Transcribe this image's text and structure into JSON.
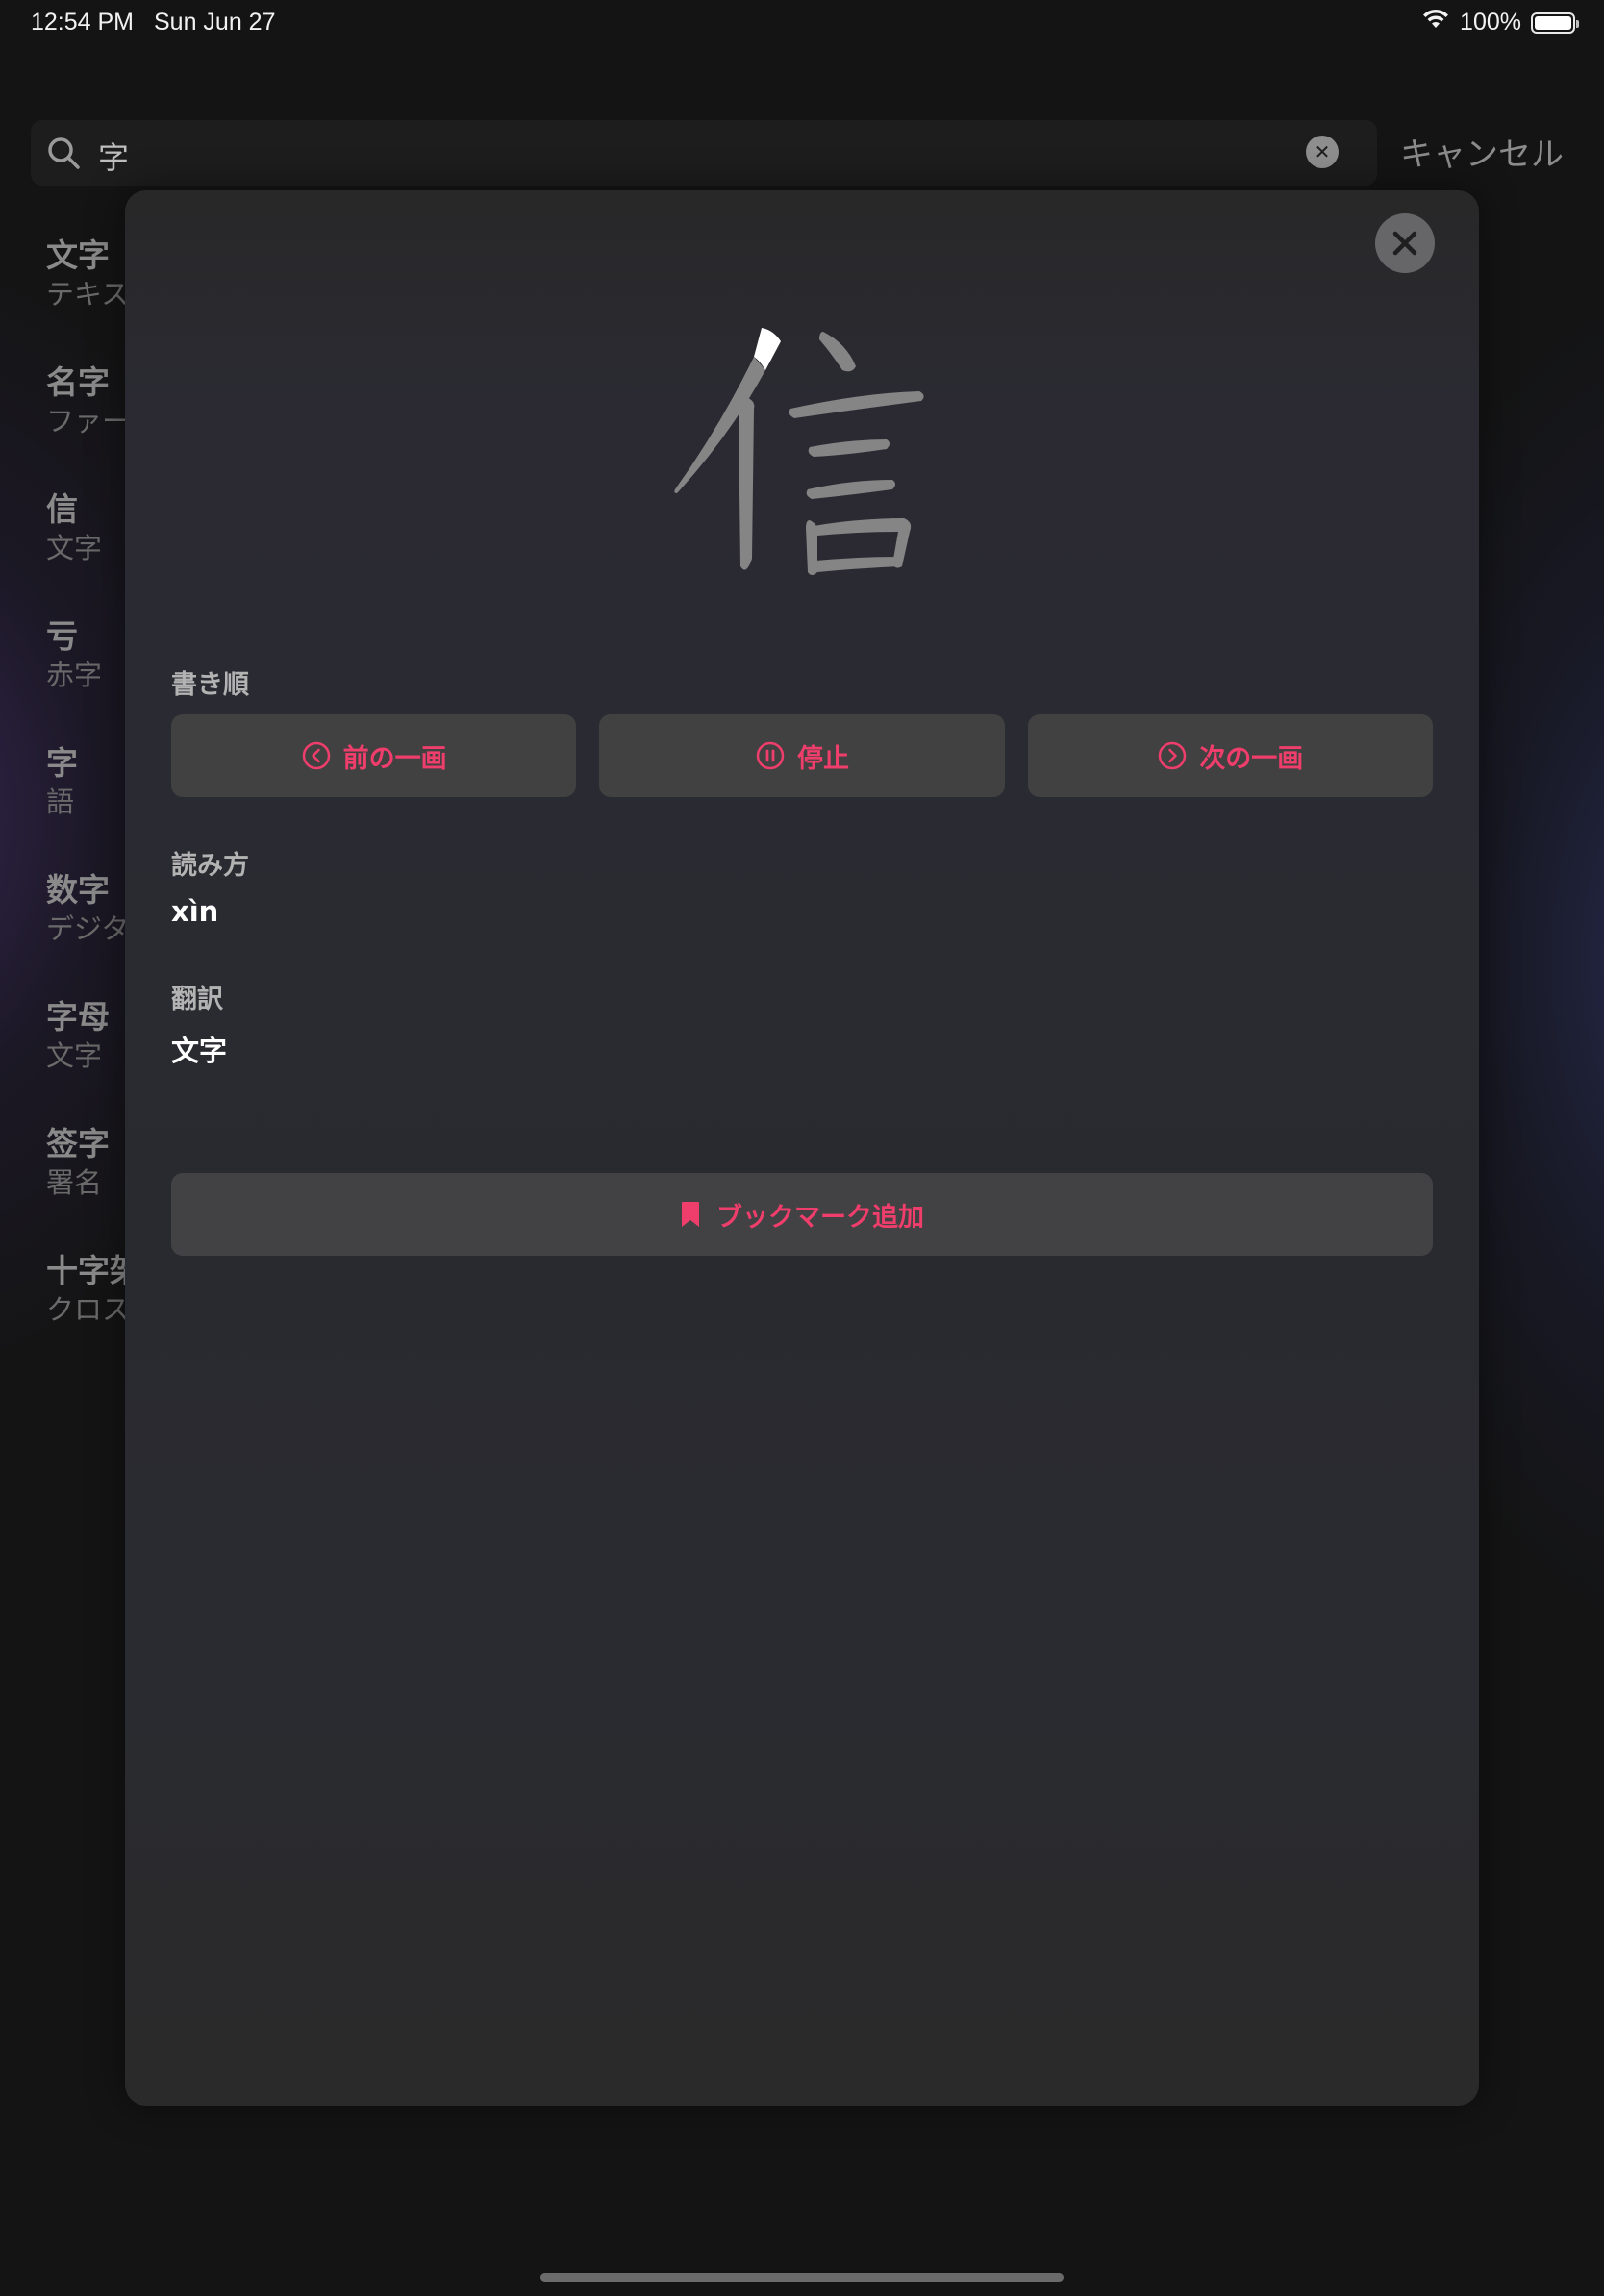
{
  "status_bar": {
    "time": "12:54 PM",
    "date": "Sun Jun 27",
    "battery_percent": "100%",
    "battery_level": 1.0
  },
  "search": {
    "query": "字",
    "cancel_label": "キャンセル"
  },
  "results": [
    {
      "title": "文字",
      "subtitle": "テキスト"
    },
    {
      "title": "名字",
      "subtitle": "ファーストネーム"
    },
    {
      "title": "信",
      "subtitle": "文字"
    },
    {
      "title": "亏",
      "subtitle": "赤字"
    },
    {
      "title": "字",
      "subtitle": "語"
    },
    {
      "title": "数字",
      "subtitle": "デジタル"
    },
    {
      "title": "字母",
      "subtitle": "文字"
    },
    {
      "title": "签字",
      "subtitle": "署名"
    },
    {
      "title": "十字架",
      "subtitle": "クロス"
    }
  ],
  "detail": {
    "character": "信",
    "stroke_order_label": "書き順",
    "prev_stroke_label": "前の一画",
    "stop_label": "停止",
    "next_stroke_label": "次の一画",
    "reading_label": "読み方",
    "reading_value": "xìn",
    "translation_label": "翻訳",
    "translation_value": "文字",
    "bookmark_label": "ブックマーク追加"
  },
  "colors": {
    "accent": "#ef3d6c",
    "modal_bg": "#2a2a2f",
    "button_bg": "#414141",
    "character_gray": "#858585",
    "current_stroke": "#ffffff"
  },
  "icons": {
    "search": "search-icon",
    "clear": "clear-icon",
    "close": "close-icon",
    "prev": "chevron-left-circle-icon",
    "stop": "pause-circle-icon",
    "next": "chevron-right-circle-icon",
    "bookmark": "bookmark-icon",
    "wifi": "wifi-icon",
    "battery": "battery-icon"
  }
}
